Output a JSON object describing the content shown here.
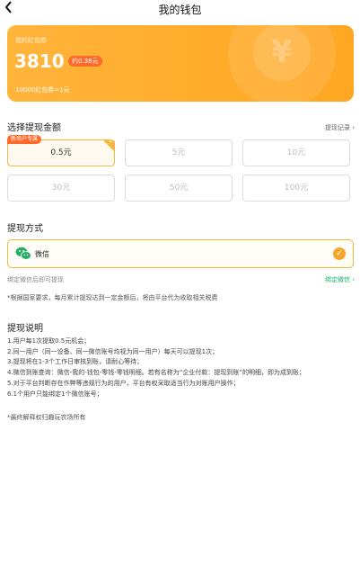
{
  "nav": {
    "back_icon": "chevron-left-icon",
    "title": "我的钱包"
  },
  "card": {
    "label": "我的红包券",
    "amount": "3810",
    "equivalent": "约0.38元",
    "rate": "10000红包券=1元",
    "accent": "#ffa722"
  },
  "amount_section": {
    "title": "选择提现金额",
    "records_link": "提现记录 ›",
    "new_user_tag": "新用户专属",
    "options": [
      "0.5元",
      "5元",
      "10元",
      "30元",
      "50元",
      "100元"
    ],
    "selected": "0.5元"
  },
  "method_section": {
    "title": "提现方式",
    "wechat_label": "微信",
    "wechat_icon": "wechat-icon",
    "bind_hint": "绑定微信后即可提现",
    "bind_link": "绑定微信 ›",
    "tax_note": "*根据国家要求，每月累计提现达到一定金额后，将由平台代为收取相关税费"
  },
  "rules_section": {
    "title": "提现说明",
    "items": [
      "1.用户每1次提取0.5元机会；",
      "2.同一用户（同一设备、同一微信账号均视为同一用户）每天可以提现1次；",
      "3.提现将在1-3个工作日审核到账，请耐心等待；",
      "4.微信到账查询：微信-我的-钱包-零钱-零钱明细。若有名称为“企业付款：提现到账”的明细，即为成到账；",
      "5.对于平台判断存在作弊等违规行为的用户，平台有权采取适当行为对账用户操作；",
      "6.1个用户只能绑定1个微信账号；"
    ],
    "footer": "*最终解释权归趣玩农场所有"
  }
}
